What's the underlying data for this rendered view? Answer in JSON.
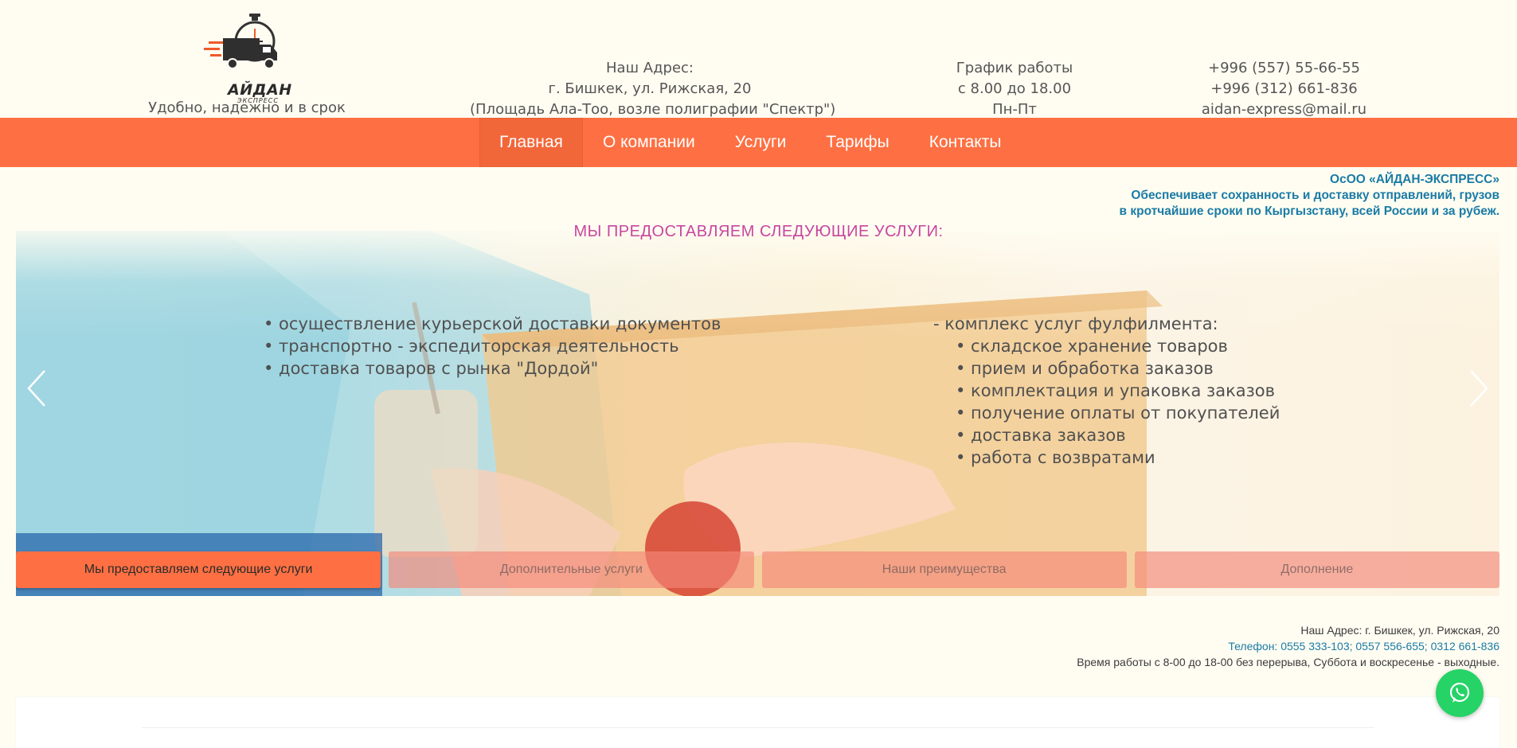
{
  "header": {
    "logo_name": "АЙДАН",
    "logo_sub": "ЭКСПРЕСС",
    "slogan": "Удобно, надежно и в срок",
    "address": {
      "title": "Наш Адрес:",
      "line1": "г. Бишкек, ул. Рижская, 20",
      "line2": "(Площадь Ала-Тоо, возле полиграфии \"Спектр\")"
    },
    "hours": {
      "title": "График работы",
      "line1": "с 8.00 до 18.00",
      "line2": "Пн-Пт"
    },
    "contacts": {
      "phone1": "+996 (557) 55-66-55",
      "phone2": "+996 (312) 661-836",
      "email": "aidan-express@mail.ru"
    }
  },
  "nav": {
    "items": [
      {
        "label": "Главная",
        "active": true
      },
      {
        "label": "О компании",
        "active": false
      },
      {
        "label": "Услуги",
        "active": false
      },
      {
        "label": "Тарифы",
        "active": false
      },
      {
        "label": "Контакты",
        "active": false
      }
    ]
  },
  "company": {
    "name": "ОсОО «АЙДАН-ЭКСПРЕСС»",
    "line1": "Обеспечивает сохранность и доставку отправлений, грузов",
    "line2": "в кротчайшие сроки по Кыргызстану, всей России и за рубеж."
  },
  "services": {
    "title": "МЫ ПРЕДОСТАВЛЯЕМ СЛЕДУЮЩИЕ УСЛУГИ:",
    "left": [
      "• осуществление курьерской доставки документов",
      "• транспортно - экспедиторская деятельность",
      "• доставка товаров с рынка \"Дордой\""
    ],
    "right_heading": "- комплекс услуг фулфилмента:",
    "right": [
      "• складское хранение товаров",
      "• прием и обработка заказов",
      "• комплектация и упаковка заказов",
      "• получение оплаты от покупателей",
      "• доставка заказов",
      "• работа с возвратами"
    ]
  },
  "slider": {
    "tabs": [
      {
        "label": "Мы предоставляем следующие услуги",
        "active": true
      },
      {
        "label": "Дополнительные услуги",
        "active": false
      },
      {
        "label": "Наши преимущества",
        "active": false
      },
      {
        "label": "Дополнение",
        "active": false
      }
    ],
    "prev_icon": "chevron-left-icon",
    "next_icon": "chevron-right-icon"
  },
  "footer": {
    "address": "Наш Адрес: г. Бишкек, ул. Рижская, 20",
    "phones": "Телефон: 0555 333-103; 0557 556-655; 0312 661-836",
    "hours": "Время работы с 8-00 до 18-00 без перерыва, Суббота и воскресенье - выходные."
  },
  "colors": {
    "accent": "#fe7043",
    "link": "#1a7ba5",
    "title": "#c8469e",
    "whatsapp": "#25d366"
  },
  "floating": {
    "icon": "whatsapp-icon"
  }
}
